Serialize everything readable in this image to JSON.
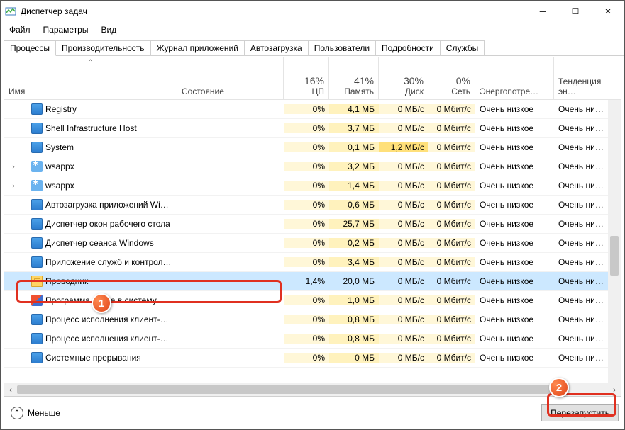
{
  "window": {
    "title": "Диспетчер задач",
    "minimize": "─",
    "maximize": "☐",
    "close": "✕"
  },
  "menu": {
    "file": "Файл",
    "options": "Параметры",
    "view": "Вид"
  },
  "tabs": [
    {
      "id": "processes",
      "label": "Процессы",
      "active": true
    },
    {
      "id": "performance",
      "label": "Производительность",
      "active": false
    },
    {
      "id": "apphistory",
      "label": "Журнал приложений",
      "active": false
    },
    {
      "id": "startup",
      "label": "Автозагрузка",
      "active": false
    },
    {
      "id": "users",
      "label": "Пользователи",
      "active": false
    },
    {
      "id": "details",
      "label": "Подробности",
      "active": false
    },
    {
      "id": "services",
      "label": "Службы",
      "active": false
    }
  ],
  "columns": {
    "name": "Имя",
    "state": "Состояние",
    "cpu_pct": "16%",
    "cpu_label": "ЦП",
    "mem_pct": "41%",
    "mem_label": "Память",
    "disk_pct": "30%",
    "disk_label": "Диск",
    "net_pct": "0%",
    "net_label": "Сеть",
    "power": "Энергопотре…",
    "trend": "Тенденция эн…"
  },
  "rows": [
    {
      "expand": "",
      "icon": "app",
      "name": "Registry",
      "cpu": "0%",
      "mem": "4,1 МБ",
      "disk": "0 МБ/с",
      "net": "0 Мбит/с",
      "power": "Очень низкое",
      "trend": "Очень низкое"
    },
    {
      "expand": "",
      "icon": "app",
      "name": "Shell Infrastructure Host",
      "cpu": "0%",
      "mem": "3,7 МБ",
      "disk": "0 МБ/с",
      "net": "0 Мбит/с",
      "power": "Очень низкое",
      "trend": "Очень низкое"
    },
    {
      "expand": "",
      "icon": "app",
      "name": "System",
      "cpu": "0%",
      "mem": "0,1 МБ",
      "disk": "1,2 МБ/с",
      "disk_hot": true,
      "net": "0 Мбит/с",
      "power": "Очень низкое",
      "trend": "Очень низкое"
    },
    {
      "expand": "›",
      "icon": "gear",
      "name": "wsappx",
      "cpu": "0%",
      "mem": "3,2 МБ",
      "disk": "0 МБ/с",
      "net": "0 Мбит/с",
      "power": "Очень низкое",
      "trend": "Очень низкое"
    },
    {
      "expand": "›",
      "icon": "gear",
      "name": "wsappx",
      "cpu": "0%",
      "mem": "1,4 МБ",
      "disk": "0 МБ/с",
      "net": "0 Мбит/с",
      "power": "Очень низкое",
      "trend": "Очень низкое"
    },
    {
      "expand": "",
      "icon": "app",
      "name": "Автозагрузка приложений Wi…",
      "cpu": "0%",
      "mem": "0,6 МБ",
      "disk": "0 МБ/с",
      "net": "0 Мбит/с",
      "power": "Очень низкое",
      "trend": "Очень низкое"
    },
    {
      "expand": "",
      "icon": "app",
      "name": "Диспетчер окон рабочего стола",
      "cpu": "0%",
      "mem": "25,7 МБ",
      "disk": "0 МБ/с",
      "net": "0 Мбит/с",
      "power": "Очень низкое",
      "trend": "Очень низкое"
    },
    {
      "expand": "",
      "icon": "app",
      "name": "Диспетчер сеанса  Windows",
      "cpu": "0%",
      "mem": "0,2 МБ",
      "disk": "0 МБ/с",
      "net": "0 Мбит/с",
      "power": "Очень низкое",
      "trend": "Очень низкое"
    },
    {
      "expand": "",
      "icon": "app",
      "name": "Приложение служб и контрол…",
      "cpu": "0%",
      "mem": "3,4 МБ",
      "disk": "0 МБ/с",
      "net": "0 Мбит/с",
      "power": "Очень низкое",
      "trend": "Очень низкое"
    },
    {
      "expand": "",
      "icon": "folder",
      "name": "Проводник",
      "cpu": "1,4%",
      "mem": "20,0 МБ",
      "disk": "0 МБ/с",
      "net": "0 Мбит/с",
      "power": "Очень низкое",
      "trend": "Очень низкое",
      "selected": true
    },
    {
      "expand": "",
      "icon": "shield",
      "name": "Программа входа в систему …",
      "cpu": "0%",
      "mem": "1,0 МБ",
      "disk": "0 МБ/с",
      "net": "0 Мбит/с",
      "power": "Очень низкое",
      "trend": "Очень низкое"
    },
    {
      "expand": "",
      "icon": "app",
      "name": "Процесс исполнения клиент-…",
      "cpu": "0%",
      "mem": "0,8 МБ",
      "disk": "0 МБ/с",
      "net": "0 Мбит/с",
      "power": "Очень низкое",
      "trend": "Очень низкое"
    },
    {
      "expand": "",
      "icon": "app",
      "name": "Процесс исполнения клиент-…",
      "cpu": "0%",
      "mem": "0,8 МБ",
      "disk": "0 МБ/с",
      "net": "0 Мбит/с",
      "power": "Очень низкое",
      "trend": "Очень низкое"
    },
    {
      "expand": "",
      "icon": "app",
      "name": "Системные прерывания",
      "cpu": "0%",
      "mem": "0 МБ",
      "disk": "0 МБ/с",
      "net": "0 Мбит/с",
      "power": "Очень низкое",
      "trend": "Очень низкое"
    }
  ],
  "footer": {
    "less": "Меньше",
    "restart": "Перезапустить"
  },
  "annotations": {
    "badge1": "1",
    "badge2": "2"
  }
}
